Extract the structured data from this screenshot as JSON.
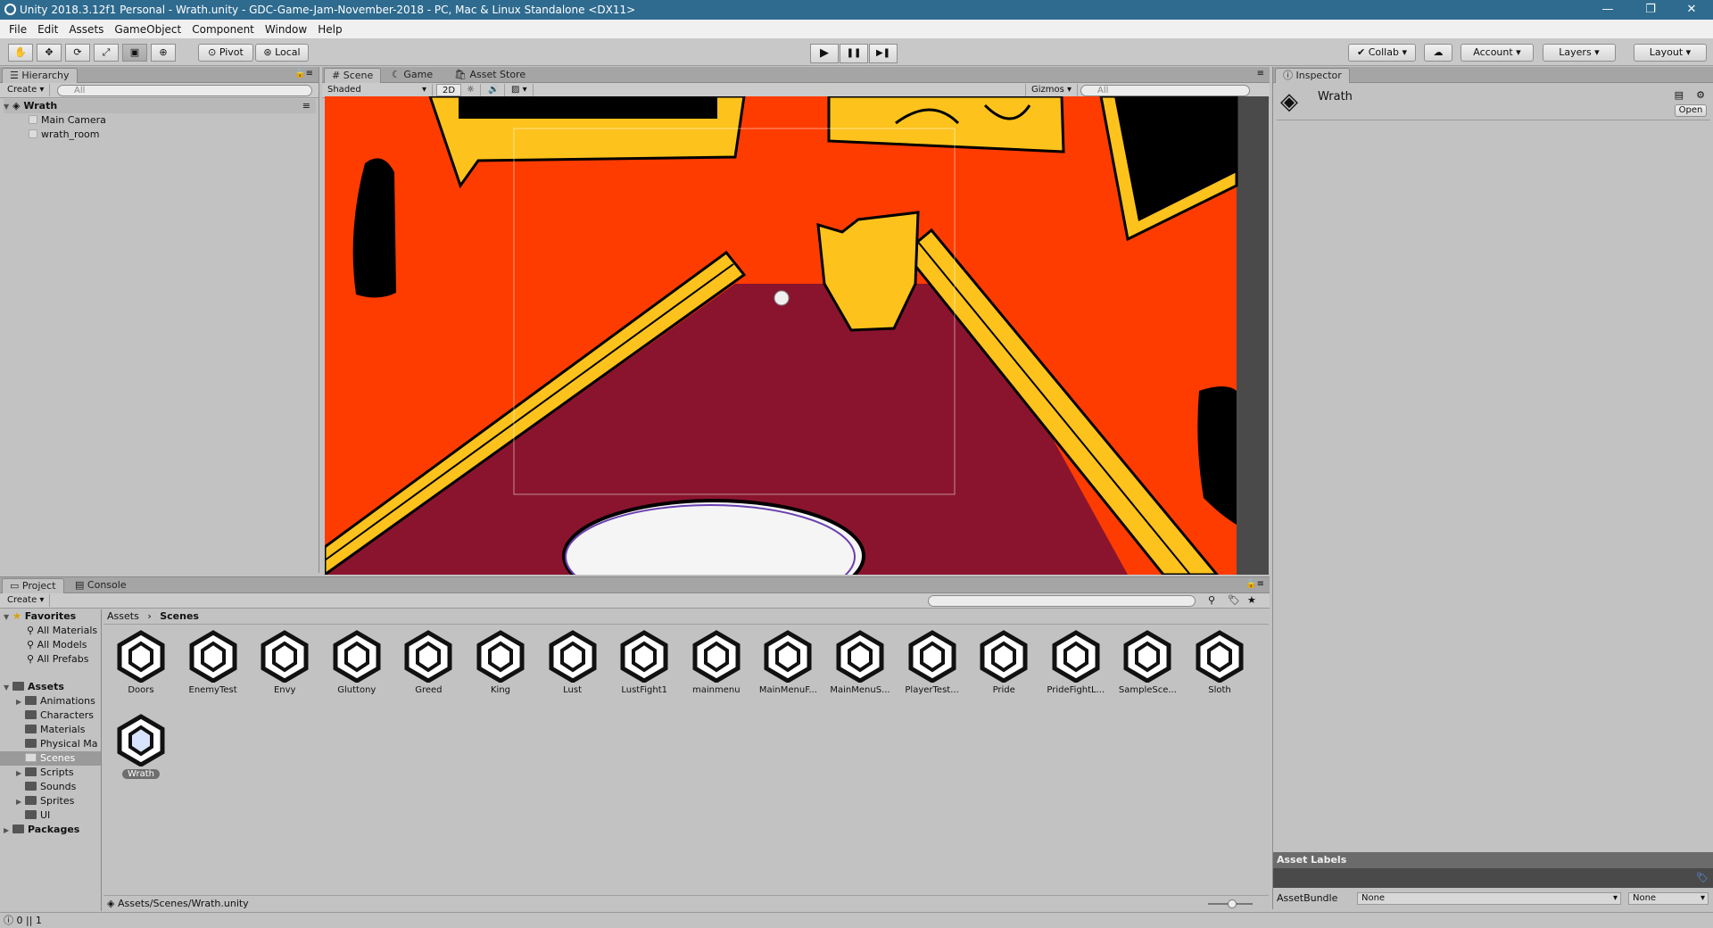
{
  "window": {
    "title": "Unity 2018.3.12f1 Personal - Wrath.unity - GDC-Game-Jam-November-2018 - PC, Mac & Linux Standalone <DX11>",
    "minimize": "—",
    "maximize": "❐",
    "close": "✕"
  },
  "menu": [
    "File",
    "Edit",
    "Assets",
    "GameObject",
    "Component",
    "Window",
    "Help"
  ],
  "toolbar": {
    "tools": [
      "hand-tool",
      "move-tool",
      "rotate-tool",
      "scale-tool",
      "rect-tool",
      "transform-tool"
    ],
    "pivot": "Pivot",
    "local": "Local",
    "play": "▶",
    "pause": "❚❚",
    "step": "▶❚",
    "collab": "Collab",
    "account": "Account",
    "layers": "Layers",
    "layout": "Layout"
  },
  "hierarchy": {
    "tab": "Hierarchy",
    "create": "Create",
    "search_placeholder": "All",
    "scene": "Wrath",
    "items": [
      "Main Camera",
      "wrath_room"
    ]
  },
  "scene": {
    "tabs": [
      "Scene",
      "Game",
      "Asset Store"
    ],
    "shading": "Shaded",
    "mode2d": "2D",
    "gizmos": "Gizmos",
    "search_placeholder": "All"
  },
  "inspector": {
    "tab": "Inspector",
    "name": "Wrath",
    "open": "Open",
    "asset_labels": "Asset Labels",
    "asset_bundle_label": "AssetBundle",
    "bundle_value": "None",
    "variant_value": "None"
  },
  "project": {
    "tabs": [
      "Project",
      "Console"
    ],
    "create": "Create",
    "breadcrumb": [
      "Assets",
      "Scenes"
    ],
    "favorites": "Favorites",
    "favorite_items": [
      "All Materials",
      "All Models",
      "All Prefabs"
    ],
    "assets_root": "Assets",
    "folders": [
      "Animations",
      "Characters",
      "Materials",
      "Physical Ma",
      "Scenes",
      "Scripts",
      "Sounds",
      "Sprites",
      "UI"
    ],
    "packages": "Packages",
    "scenes": [
      "Doors",
      "EnemyTest",
      "Envy",
      "Gluttony",
      "Greed",
      "King",
      "Lust",
      "LustFight1",
      "mainmenu",
      "MainMenuF...",
      "MainMenuS...",
      "PlayerTest...",
      "Pride",
      "PrideFightL...",
      "SampleSce...",
      "Sloth",
      "Wrath"
    ],
    "selected_scene": "Wrath",
    "path": "Assets/Scenes/Wrath.unity"
  },
  "status": {
    "text": "0 || 1"
  },
  "colors": {
    "titlebar": "#2e6b8f",
    "scene_bg": "#ff3c00",
    "gold": "#fdc31c",
    "maroon": "#8a142e"
  }
}
